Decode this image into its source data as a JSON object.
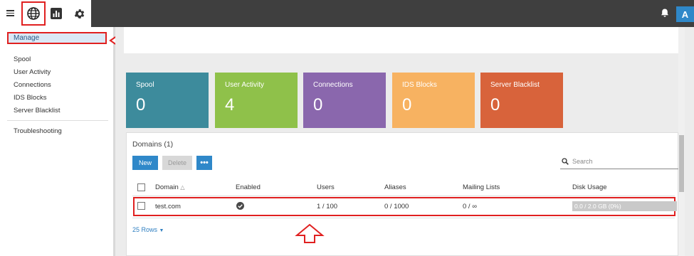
{
  "colors": {
    "topbar": "#3f3f3f",
    "accent_blue": "#2f88c9",
    "annotation_red": "#e02020",
    "card_spool": "#3d8b9c",
    "card_user_activity": "#8fc14a",
    "card_connections": "#8a67ad",
    "card_ids_blocks": "#f7b261",
    "card_server_blacklist": "#d8633b"
  },
  "topbar": {
    "icons": [
      "menu-icon",
      "globe-icon",
      "bar-chart-icon",
      "gear-icon",
      "bell-icon"
    ],
    "avatar_letter": "A"
  },
  "sidebar": {
    "active": "Manage",
    "items": [
      "Spool",
      "User Activity",
      "Connections",
      "IDS Blocks",
      "Server Blacklist"
    ],
    "footer_item": "Troubleshooting"
  },
  "cards": [
    {
      "title": "Spool",
      "value": "0"
    },
    {
      "title": "User Activity",
      "value": "4"
    },
    {
      "title": "Connections",
      "value": "0"
    },
    {
      "title": "IDS Blocks",
      "value": "0"
    },
    {
      "title": "Server Blacklist",
      "value": "0"
    }
  ],
  "domains": {
    "title": "Domains (1)",
    "buttons": {
      "new": "New",
      "delete": "Delete",
      "more": "•••"
    },
    "search_placeholder": "Search",
    "columns": [
      "Domain",
      "Enabled",
      "Users",
      "Aliases",
      "Mailing Lists",
      "Disk Usage"
    ],
    "sort_indicator": "△",
    "rows": [
      {
        "domain": "test.com",
        "enabled": true,
        "users": "1 / 100",
        "aliases": "0 / 1000",
        "mailing_lists": "0 / ∞",
        "disk_usage": "0.0 / 2.0 GB (0%)"
      }
    ],
    "rows_per_page": "25 Rows"
  }
}
